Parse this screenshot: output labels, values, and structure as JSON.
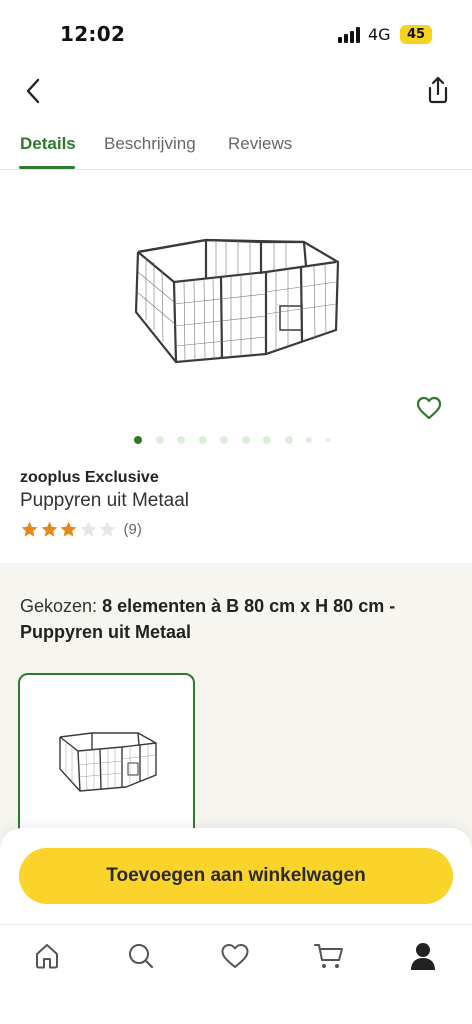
{
  "status_bar": {
    "time": "12:02",
    "network": "4G",
    "battery": "45"
  },
  "header": {
    "back_icon": "chevron-left-icon",
    "share_icon": "share-icon"
  },
  "tabs": [
    {
      "label": "Details",
      "active": true
    },
    {
      "label": "Beschrijving",
      "active": false
    },
    {
      "label": "Reviews",
      "active": false
    }
  ],
  "product": {
    "brand": "zooplus Exclusive",
    "name": "Puppyren uit Metaal",
    "rating": 3,
    "rating_max": 5,
    "review_count": "(9)",
    "image_count": 10,
    "active_image": 1
  },
  "variant": {
    "label": "Gekozen:",
    "value": "8 elementen à B 80 cm x H 80 cm - Puppyren uit Metaal"
  },
  "cart": {
    "button_label": "Toevoegen aan winkelwagen"
  },
  "nav": {
    "items": [
      "home-icon",
      "search-icon",
      "heart-icon",
      "cart-icon",
      "account-icon"
    ]
  },
  "colors": {
    "accent_green": "#2d7a2d",
    "cta_yellow": "#fad32b",
    "star_orange": "#e6891a"
  }
}
